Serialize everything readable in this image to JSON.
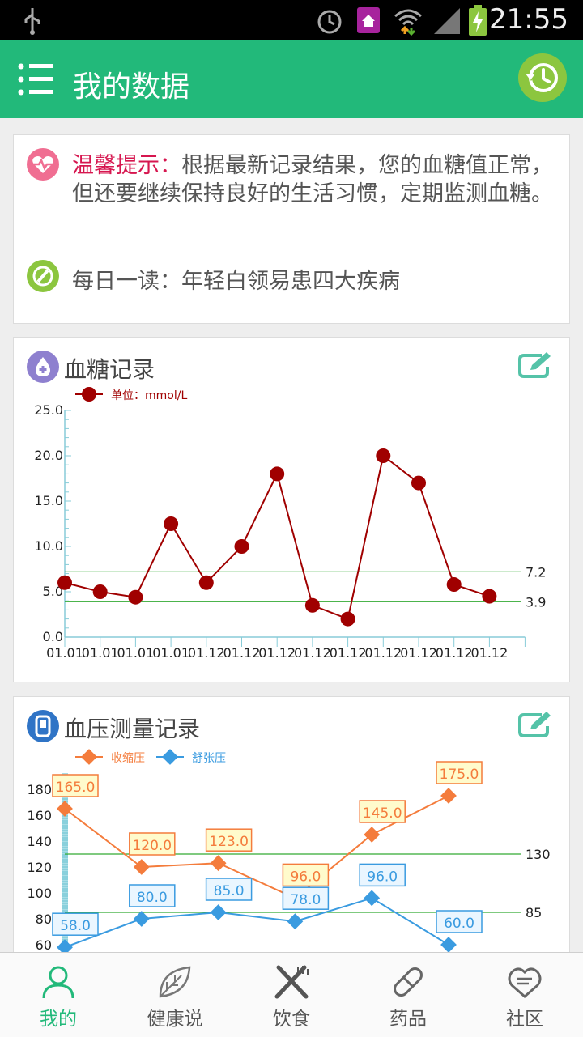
{
  "status": {
    "time": "21:55"
  },
  "header": {
    "title": "我的数据"
  },
  "tip": {
    "label": "温馨提示：",
    "text": "根据最新记录结果，您的血糖值正常，但还要继续保持良好的生活习惯，定期监测血糖。",
    "daily_read": "每日一读：年轻白领易患四大疾病"
  },
  "glucose": {
    "title": "血糖记录",
    "legend": "单位：mmol/L"
  },
  "bp": {
    "title": "血压测量记录",
    "legend_systolic": "收缩压",
    "legend_diastolic": "舒张压"
  },
  "nav": [
    {
      "label": "我的"
    },
    {
      "label": "健康说"
    },
    {
      "label": "饮食"
    },
    {
      "label": "药品"
    },
    {
      "label": "社区"
    }
  ],
  "chart_data": [
    {
      "type": "line",
      "title": "血糖记录",
      "series": [
        {
          "name": "单位：mmol/L",
          "values": [
            6.0,
            5.0,
            4.4,
            12.5,
            6.0,
            10.0,
            18.0,
            3.5,
            2.0,
            20.0,
            17.0,
            5.8,
            4.5
          ]
        }
      ],
      "x": [
        "01.01",
        "01.01",
        "01.01",
        "01.01",
        "01.12",
        "01.12",
        "01.12",
        "01.12",
        "01.12",
        "01.12",
        "01.12",
        "01.12",
        "01.12"
      ],
      "ylim": [
        0,
        25
      ],
      "yticks": [
        "0.0",
        "5.0",
        "10.0",
        "15.0",
        "20.0",
        "25.0"
      ],
      "reference_lines": [
        {
          "value": 7.2,
          "label": "7.2"
        },
        {
          "value": 3.9,
          "label": "3.9"
        }
      ],
      "colors": {
        "series": "#a00000",
        "reference": "#33aa33"
      }
    },
    {
      "type": "line",
      "title": "血压测量记录",
      "series": [
        {
          "name": "收缩压",
          "values": [
            165.0,
            120.0,
            123.0,
            96.0,
            145.0,
            175.0
          ],
          "labels": [
            "165.0",
            "120.0",
            "123.0",
            "96.0",
            "145.0",
            "175.0"
          ]
        },
        {
          "name": "舒张压",
          "values": [
            58.0,
            80.0,
            85.0,
            78.0,
            96.0,
            60.0
          ],
          "labels": [
            "58.0",
            "80.0",
            "85.0",
            "78.0",
            "96.0",
            "60.0"
          ]
        }
      ],
      "yticks": [
        "60",
        "80",
        "100",
        "120",
        "140",
        "160",
        "180"
      ],
      "reference_lines": [
        {
          "value": 130,
          "label": "130"
        },
        {
          "value": 85,
          "label": "85"
        }
      ],
      "colors": {
        "systolic": "#f47c3c",
        "diastolic": "#3a9be0",
        "reference": "#33aa33"
      }
    }
  ]
}
